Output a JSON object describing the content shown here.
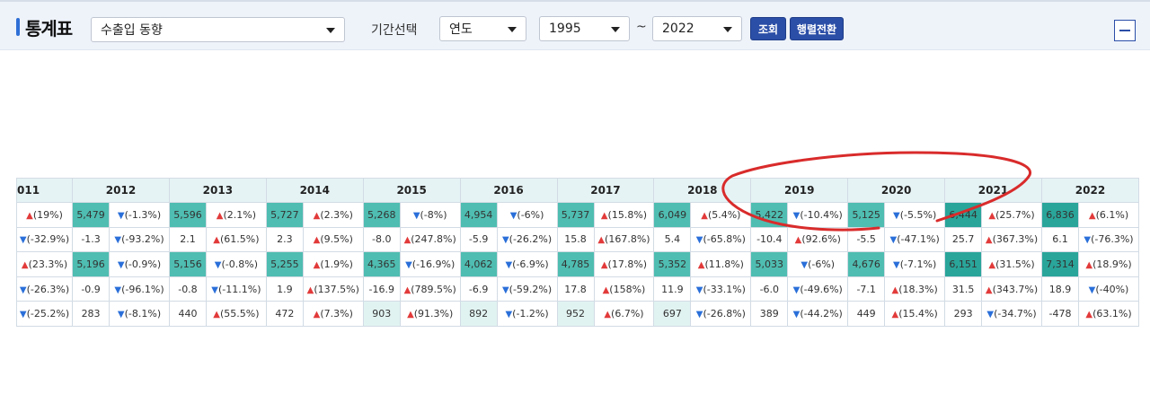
{
  "header": {
    "title": "통계표",
    "category_select": "수출입 동향",
    "period_label": "기간선택",
    "unit_select": "연도",
    "from_year": "1995",
    "tilde": "~",
    "to_year": "2022",
    "search_button": "조회",
    "transpose_button": "행렬전환"
  },
  "table": {
    "years": [
      "011",
      "2012",
      "2013",
      "2014",
      "2015",
      "2016",
      "2017",
      "2018",
      "2019",
      "2020",
      "2021",
      "2022"
    ],
    "rows": [
      {
        "lead": {
          "dir": "up",
          "txt": "(19%)"
        },
        "cells": [
          {
            "v": "5,479",
            "s": "c1",
            "dir": "dn",
            "txt": "(-1.3%)"
          },
          {
            "v": "5,596",
            "s": "c1",
            "dir": "up",
            "txt": "(2.1%)"
          },
          {
            "v": "5,727",
            "s": "c1",
            "dir": "up",
            "txt": "(2.3%)"
          },
          {
            "v": "5,268",
            "s": "c1",
            "dir": "dn",
            "txt": "(-8%)"
          },
          {
            "v": "4,954",
            "s": "c1",
            "dir": "dn",
            "txt": "(-6%)"
          },
          {
            "v": "5,737",
            "s": "c1",
            "dir": "up",
            "txt": "(15.8%)"
          },
          {
            "v": "6,049",
            "s": "c1",
            "dir": "up",
            "txt": "(5.4%)"
          },
          {
            "v": "5,422",
            "s": "c1",
            "dir": "dn",
            "txt": "(-10.4%)"
          },
          {
            "v": "5,125",
            "s": "c1",
            "dir": "dn",
            "txt": "(-5.5%)"
          },
          {
            "v": "6,444",
            "s": "c3",
            "dir": "up",
            "txt": "(25.7%)"
          },
          {
            "v": "6,836",
            "s": "c3",
            "dir": "up",
            "txt": "(6.1%)"
          }
        ]
      },
      {
        "lead": {
          "dir": "dn",
          "txt": "(-32.9%)"
        },
        "cells": [
          {
            "v": "-1.3",
            "s": "",
            "dir": "dn",
            "txt": "(-93.2%)"
          },
          {
            "v": "2.1",
            "s": "",
            "dir": "up",
            "txt": "(61.5%)"
          },
          {
            "v": "2.3",
            "s": "",
            "dir": "up",
            "txt": "(9.5%)"
          },
          {
            "v": "-8.0",
            "s": "",
            "dir": "up",
            "txt": "(247.8%)"
          },
          {
            "v": "-5.9",
            "s": "",
            "dir": "dn",
            "txt": "(-26.2%)"
          },
          {
            "v": "15.8",
            "s": "",
            "dir": "up",
            "txt": "(167.8%)"
          },
          {
            "v": "5.4",
            "s": "",
            "dir": "dn",
            "txt": "(-65.8%)"
          },
          {
            "v": "-10.4",
            "s": "",
            "dir": "up",
            "txt": "(92.6%)"
          },
          {
            "v": "-5.5",
            "s": "",
            "dir": "dn",
            "txt": "(-47.1%)"
          },
          {
            "v": "25.7",
            "s": "",
            "dir": "up",
            "txt": "(367.3%)"
          },
          {
            "v": "6.1",
            "s": "",
            "dir": "dn",
            "txt": "(-76.3%)"
          }
        ]
      },
      {
        "lead": {
          "dir": "up",
          "txt": "(23.3%)"
        },
        "cells": [
          {
            "v": "5,196",
            "s": "c1",
            "dir": "dn",
            "txt": "(-0.9%)"
          },
          {
            "v": "5,156",
            "s": "c1",
            "dir": "dn",
            "txt": "(-0.8%)"
          },
          {
            "v": "5,255",
            "s": "c1",
            "dir": "up",
            "txt": "(1.9%)"
          },
          {
            "v": "4,365",
            "s": "c1",
            "dir": "dn",
            "txt": "(-16.9%)"
          },
          {
            "v": "4,062",
            "s": "c1",
            "dir": "dn",
            "txt": "(-6.9%)"
          },
          {
            "v": "4,785",
            "s": "c1",
            "dir": "up",
            "txt": "(17.8%)"
          },
          {
            "v": "5,352",
            "s": "c1",
            "dir": "up",
            "txt": "(11.8%)"
          },
          {
            "v": "5,033",
            "s": "c1",
            "dir": "dn",
            "txt": "(-6%)"
          },
          {
            "v": "4,676",
            "s": "c1",
            "dir": "dn",
            "txt": "(-7.1%)"
          },
          {
            "v": "6,151",
            "s": "c3",
            "dir": "up",
            "txt": "(31.5%)"
          },
          {
            "v": "7,314",
            "s": "c3",
            "dir": "up",
            "txt": "(18.9%)"
          }
        ]
      },
      {
        "lead": {
          "dir": "dn",
          "txt": "(-26.3%)"
        },
        "cells": [
          {
            "v": "-0.9",
            "s": "",
            "dir": "dn",
            "txt": "(-96.1%)"
          },
          {
            "v": "-0.8",
            "s": "",
            "dir": "dn",
            "txt": "(-11.1%)"
          },
          {
            "v": "1.9",
            "s": "",
            "dir": "up",
            "txt": "(137.5%)"
          },
          {
            "v": "-16.9",
            "s": "",
            "dir": "up",
            "txt": "(789.5%)"
          },
          {
            "v": "-6.9",
            "s": "",
            "dir": "dn",
            "txt": "(-59.2%)"
          },
          {
            "v": "17.8",
            "s": "",
            "dir": "up",
            "txt": "(158%)"
          },
          {
            "v": "11.9",
            "s": "",
            "dir": "dn",
            "txt": "(-33.1%)"
          },
          {
            "v": "-6.0",
            "s": "",
            "dir": "dn",
            "txt": "(-49.6%)"
          },
          {
            "v": "-7.1",
            "s": "",
            "dir": "up",
            "txt": "(18.3%)"
          },
          {
            "v": "31.5",
            "s": "",
            "dir": "up",
            "txt": "(343.7%)"
          },
          {
            "v": "18.9",
            "s": "",
            "dir": "dn",
            "txt": "(-40%)"
          }
        ]
      },
      {
        "lead": {
          "dir": "dn",
          "txt": "(-25.2%)"
        },
        "cells": [
          {
            "v": "283",
            "s": "",
            "dir": "dn",
            "txt": "(-8.1%)"
          },
          {
            "v": "440",
            "s": "",
            "dir": "up",
            "txt": "(55.5%)"
          },
          {
            "v": "472",
            "s": "",
            "dir": "up",
            "txt": "(7.3%)"
          },
          {
            "v": "903",
            "s": "c2",
            "dir": "up",
            "txt": "(91.3%)"
          },
          {
            "v": "892",
            "s": "c2",
            "dir": "dn",
            "txt": "(-1.2%)"
          },
          {
            "v": "952",
            "s": "c2",
            "dir": "up",
            "txt": "(6.7%)"
          },
          {
            "v": "697",
            "s": "c2",
            "dir": "dn",
            "txt": "(-26.8%)"
          },
          {
            "v": "389",
            "s": "",
            "dir": "dn",
            "txt": "(-44.2%)"
          },
          {
            "v": "449",
            "s": "",
            "dir": "up",
            "txt": "(15.4%)"
          },
          {
            "v": "293",
            "s": "",
            "dir": "dn",
            "txt": "(-34.7%)"
          },
          {
            "v": "-478",
            "s": "",
            "dir": "up",
            "txt": "(63.1%)"
          }
        ]
      }
    ]
  },
  "colors": {
    "accent": "#2b4ea7",
    "header_bg": "#e6f3f5",
    "up": "#e23a3a",
    "down": "#2a6fd9",
    "highlight": "#4fbdb1",
    "annotation": "#d92b2b"
  }
}
